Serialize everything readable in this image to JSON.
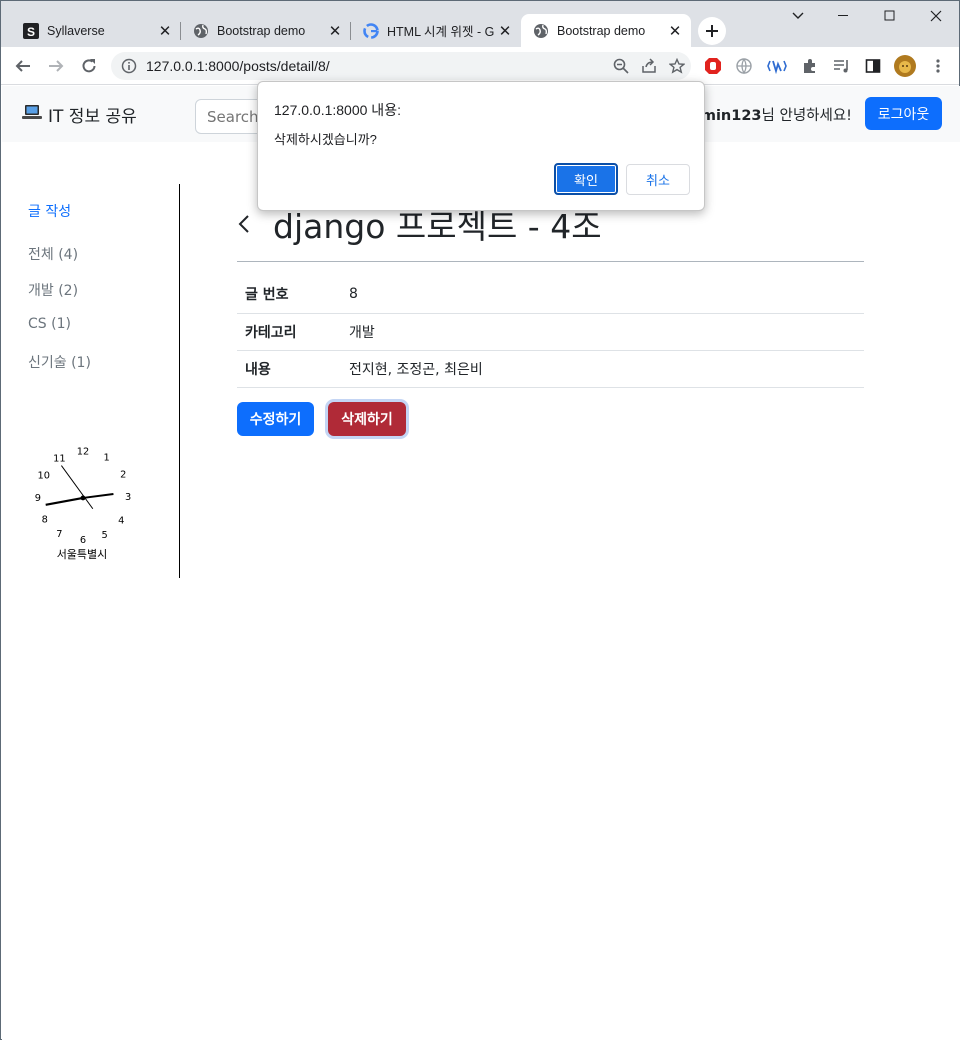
{
  "browser": {
    "tabs": [
      {
        "title": "Syllaverse",
        "favicon": "syllaverse-s-icon"
      },
      {
        "title": "Bootstrap demo",
        "favicon": "globe-icon"
      },
      {
        "title": "HTML 시계 위젯 - G",
        "favicon": "google-g-icon"
      },
      {
        "title": "Bootstrap demo",
        "favicon": "globe-icon",
        "active": true
      }
    ],
    "url": "127.0.0.1:8000/posts/detail/8/"
  },
  "navbar": {
    "brand": "IT 정보 공유",
    "search_placeholder": "Search",
    "user_name": "admin123",
    "greeting_suffix": "님 안녕하세요!",
    "logout_label": "로그아웃"
  },
  "sidebar": {
    "write_label": "글 작성",
    "categories": [
      "전체 (4)",
      "개발 (2)",
      "CS (1)",
      "신기술 (1)"
    ]
  },
  "clock": {
    "numbers": [
      "12",
      "1",
      "2",
      "3",
      "4",
      "5",
      "6",
      "7",
      "8",
      "9",
      "10",
      "11"
    ],
    "city": "서울특별시"
  },
  "post": {
    "title": "django 프로젝트 - 4조",
    "rows": [
      {
        "label": "글 번호",
        "value": "8"
      },
      {
        "label": "카테고리",
        "value": "개발"
      },
      {
        "label": "내용",
        "value": "전지현, 조정곤, 최은비"
      }
    ],
    "edit_label": "수정하기",
    "delete_label": "삭제하기"
  },
  "dialog": {
    "title": "127.0.0.1:8000 내용:",
    "message": "삭제하시겠습니까?",
    "ok_label": "확인",
    "cancel_label": "취소"
  },
  "colors": {
    "primary": "#0d6efd",
    "danger": "#b02a37",
    "dialog_primary": "#1a73e8"
  }
}
